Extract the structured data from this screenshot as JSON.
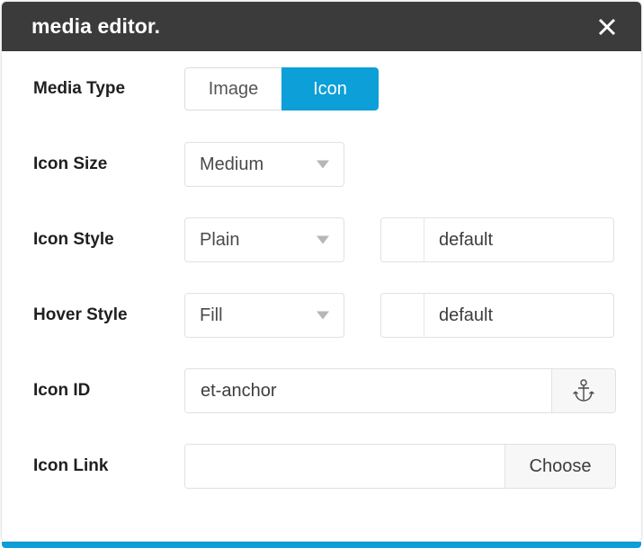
{
  "dialog": {
    "title": "media editor.",
    "close_icon": "close-icon",
    "accent_color": "#0c9fd8",
    "titlebar_color": "#3b3b3b"
  },
  "rows": {
    "media_type": {
      "label": "Media Type",
      "options": [
        {
          "label": "Image",
          "active": false
        },
        {
          "label": "Icon",
          "active": true
        }
      ]
    },
    "icon_size": {
      "label": "Icon Size",
      "value": "Medium",
      "caret_icon": "chevron-down-icon"
    },
    "icon_style": {
      "label": "Icon Style",
      "value": "Plain",
      "caret_icon": "chevron-down-icon",
      "color_value": "default",
      "swatch_color": "#ffffff"
    },
    "hover_style": {
      "label": "Hover Style",
      "value": "Fill",
      "caret_icon": "chevron-down-icon",
      "color_value": "default",
      "swatch_color": "#ffffff"
    },
    "icon_id": {
      "label": "Icon ID",
      "value": "et-anchor",
      "placeholder": "",
      "button_icon": "anchor-icon"
    },
    "icon_link": {
      "label": "Icon Link",
      "value": "",
      "placeholder": "",
      "button_label": "Choose"
    }
  }
}
